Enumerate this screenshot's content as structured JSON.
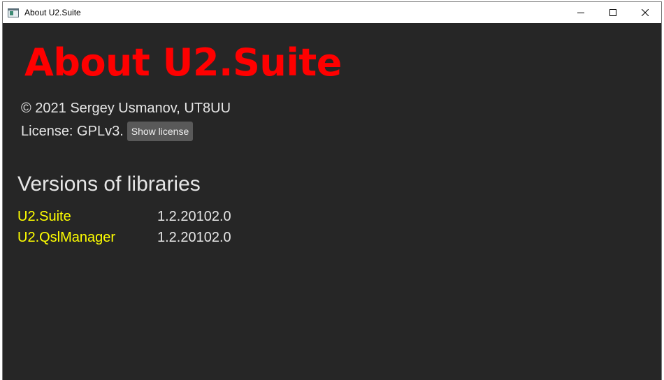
{
  "window": {
    "title": "About U2.Suite"
  },
  "about": {
    "heading": "About U2.Suite",
    "copyright": "© 2021 Sergey Usmanov, UT8UU",
    "license_text": "License: GPLv3.",
    "show_license_label": "Show license"
  },
  "libraries": {
    "title": "Versions of libraries",
    "rows": [
      {
        "name": "U2.Suite",
        "version": "1.2.20102.0"
      },
      {
        "name": "U2.QslManager",
        "version": "1.2.20102.0"
      }
    ]
  },
  "colors": {
    "heading": "#ff0000",
    "library_name": "#ffff00",
    "background": "#262626",
    "text": "#e6e6e6",
    "button": "#595959"
  },
  "icons": {
    "app": "app-window-icon",
    "minimize": "minimize-icon",
    "maximize": "maximize-icon",
    "close": "close-icon"
  }
}
